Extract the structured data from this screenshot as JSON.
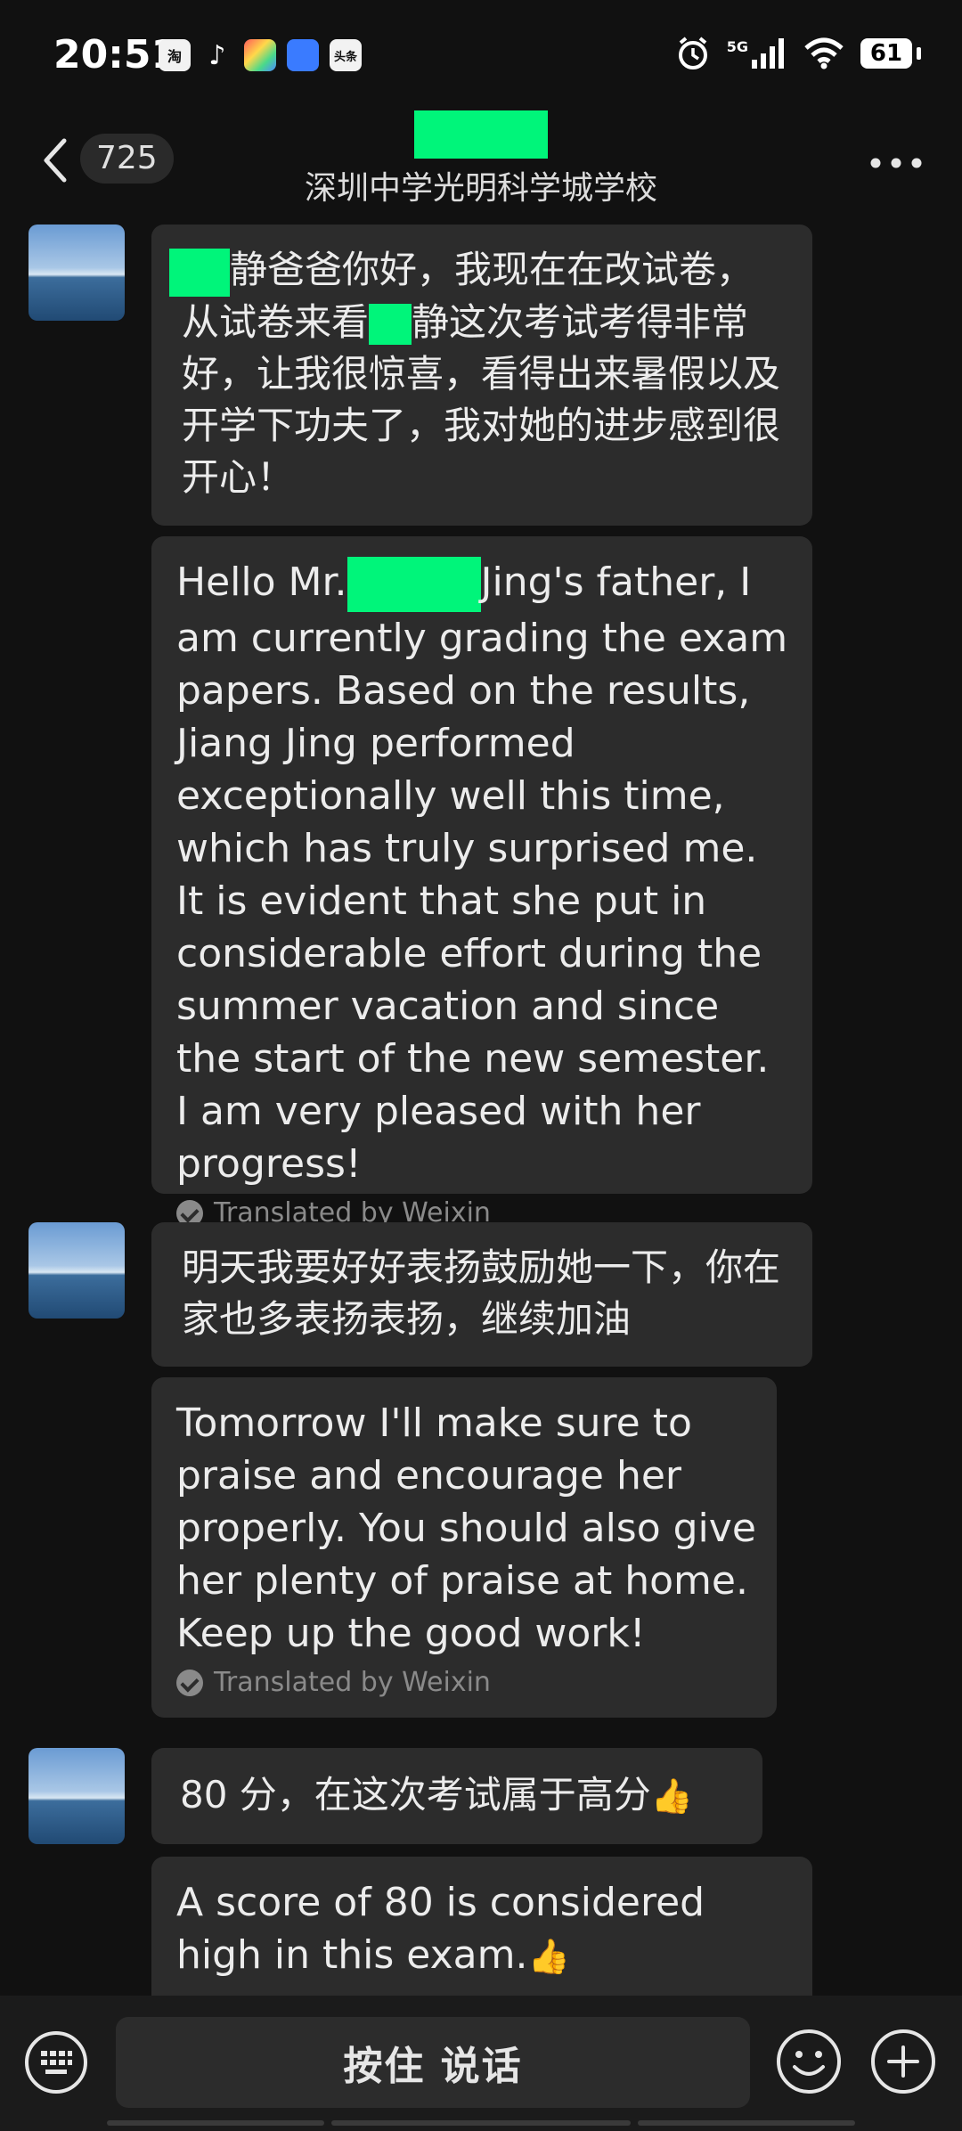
{
  "status_bar": {
    "time": "20:51",
    "apps": [
      "淘",
      "♪",
      "",
      "",
      "头条"
    ],
    "network": "5G",
    "battery": "61"
  },
  "header": {
    "unread_count": "725",
    "subtitle": "深圳中学光明科学城学校"
  },
  "messages": [
    {
      "zh_after_redact": "静爸爸你好，我现在在改试卷，",
      "zh_line2_before": "从试卷来看",
      "zh_line2_after": "静这次考试考得非常",
      "zh_rest": "好，让我很惊喜，看得出来暑假以及开学下功夫了，我对她的进步感到很开心！",
      "en_before": "Hello Mr.",
      "en_after": "Jing's father, I am currently grading the exam papers. Based on the results, Jiang Jing performed exceptionally well this time, which has truly surprised me. It is evident that she put in considerable effort during the summer vacation and since the start of the new semester. I am very pleased with her progress!",
      "translated_label": "Translated by Weixin"
    },
    {
      "zh": "明天我要好好表扬鼓励她一下，你在家也多表扬表扬，继续加油",
      "en": "Tomorrow I'll make sure to praise and encourage her properly. You should also give her plenty of praise at home. Keep up the good work!",
      "translated_label": "Translated by Weixin"
    },
    {
      "zh": "80 分，在这次考试属于高分",
      "en": "A score of 80 is considered high in this exam.",
      "emoji": "👍"
    }
  ],
  "bottom_bar": {
    "talk_label": "按住 说话"
  },
  "colors": {
    "background": "#111111",
    "bubble": "#2c2c2c",
    "redaction": "#00f57a"
  }
}
